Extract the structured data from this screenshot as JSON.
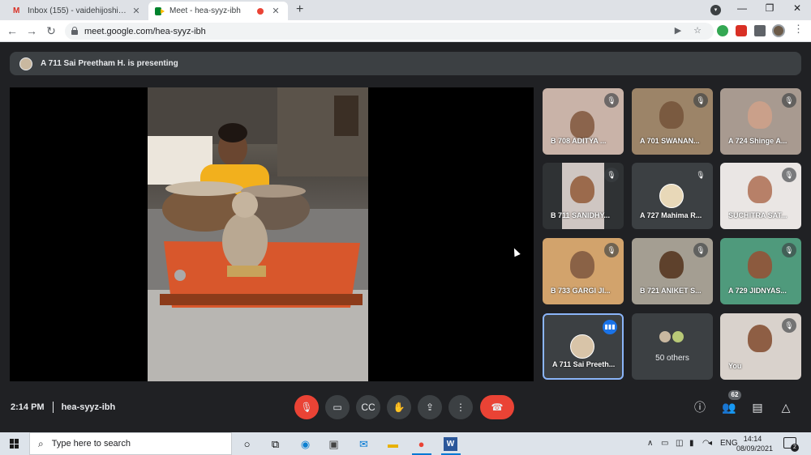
{
  "browser": {
    "tabs": [
      {
        "title": "Inbox (155) - vaidehijoshi@mes.a",
        "icon": "gmail-icon"
      },
      {
        "title": "Meet - hea-syyz-ibh",
        "icon": "meet-icon",
        "recording": true
      }
    ],
    "url": "meet.google.com/hea-syyz-ibh"
  },
  "meet": {
    "presenting_text": "A 711 Sai Preetham H. is presenting",
    "participants": [
      {
        "name": "B 708 ADITYA ...",
        "muted": true
      },
      {
        "name": "A 701 SWANAN...",
        "muted": true
      },
      {
        "name": "A 724 Shinge A...",
        "muted": true
      },
      {
        "name": "B 711 SANIDHY...",
        "muted": true
      },
      {
        "name": "A 727 Mahima R...",
        "muted": true
      },
      {
        "name": "SUCHITRA SAT...",
        "muted": true
      },
      {
        "name": "B 733 GARGI JI...",
        "muted": true
      },
      {
        "name": "B 721 ANIKET S...",
        "muted": true
      },
      {
        "name": "A 729 JIDNYAS...",
        "muted": true
      },
      {
        "name": "A 711 Sai Preeth...",
        "speaking": true
      },
      {
        "name": "You",
        "muted": true
      }
    ],
    "others_label": "50 others",
    "time": "2:14 PM",
    "meeting_code": "hea-syyz-ibh",
    "people_count": "62"
  },
  "taskbar": {
    "search_placeholder": "Type here to search",
    "language": "ENG",
    "time": "14:14",
    "date": "08/09/2021",
    "notification_count": "2"
  },
  "colors": {
    "end_call": "#ea4335",
    "meet_bg": "#202124",
    "tile_bg": "#3c4043",
    "speaker_ring": "#8ab4f8"
  }
}
